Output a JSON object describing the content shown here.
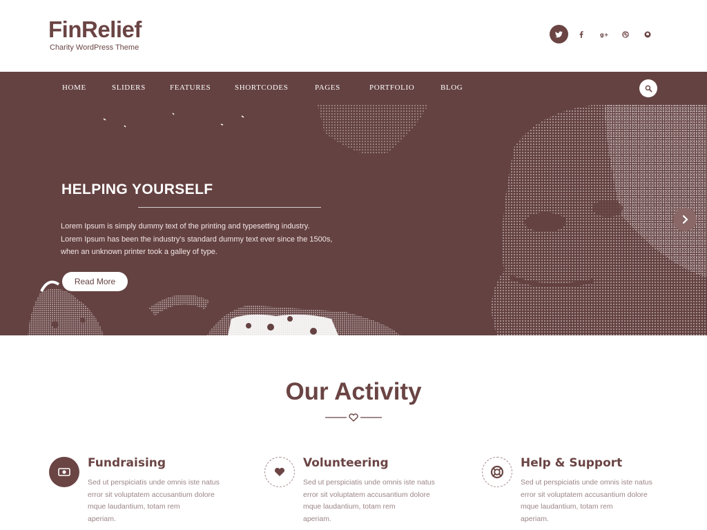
{
  "site": {
    "title": "FinRelief",
    "tagline": "Charity WordPress Theme"
  },
  "social": [
    {
      "name": "twitter-icon"
    },
    {
      "name": "facebook-icon"
    },
    {
      "name": "google-plus-icon"
    },
    {
      "name": "dribbble-icon"
    },
    {
      "name": "github-icon"
    }
  ],
  "nav": {
    "items": [
      "HOME",
      "SLIDERS",
      "FEATURES",
      "SHORTCODES",
      "PAGES",
      "PORTFOLIO",
      "BLOG"
    ]
  },
  "hero": {
    "title": "HELPING YOURSELF",
    "text_line1": "Lorem Ipsum is simply dummy text of the printing and typesetting industry.",
    "text_line2": "Lorem Ipsum has been the industry's standard dummy text ever since the 1500s,",
    "text_line3": "when an unknown printer took a galley of type.",
    "button_label": "Read More"
  },
  "activity": {
    "title": "Our Activity",
    "features": [
      {
        "title": "Fundraising",
        "icon": "money-icon",
        "text_line1": "Sed ut perspiciatis unde omnis iste natus",
        "text_line2": "error sit voluptatem accusantium dolore",
        "text_line3": "mque laudantium, totam rem",
        "text_line4": "aperiam."
      },
      {
        "title": "Volunteering",
        "icon": "heart-icon",
        "text_line1": "Sed ut perspiciatis unde omnis iste natus",
        "text_line2": "error sit voluptatem accusantium dolore",
        "text_line3": "mque laudantium, totam rem",
        "text_line4": "aperiam."
      },
      {
        "title": "Help & Support",
        "icon": "life-ring-icon",
        "text_line1": "Sed ut perspiciatis unde omnis iste natus",
        "text_line2": "error sit voluptatem accusantium dolore",
        "text_line3": "mque laudantium, totam rem",
        "text_line4": "aperiam."
      }
    ]
  },
  "colors": {
    "brand": "#6b4444",
    "nav_bg": "#654242"
  }
}
